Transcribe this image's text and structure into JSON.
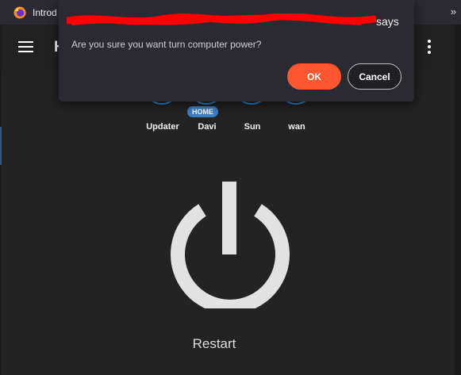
{
  "browser": {
    "tab_title": "Introd",
    "overflow_glyph": "»"
  },
  "app": {
    "title": "H"
  },
  "devices": [
    {
      "label": "Updater"
    },
    {
      "label": "Davi",
      "badge": "HOME"
    },
    {
      "label": "Sun"
    },
    {
      "label": "wan"
    }
  ],
  "power": {
    "label": "Restart"
  },
  "dialog": {
    "title_suffix": "says",
    "message": "Are you sure you want turn computer power?",
    "ok_label": "OK",
    "cancel_label": "Cancel"
  },
  "colors": {
    "accent": "#ff5831",
    "device_ring": "#2f8fd6",
    "badge": "#3d7fc3",
    "power_icon": "#e2e2e2",
    "redaction": "#ff0000"
  }
}
